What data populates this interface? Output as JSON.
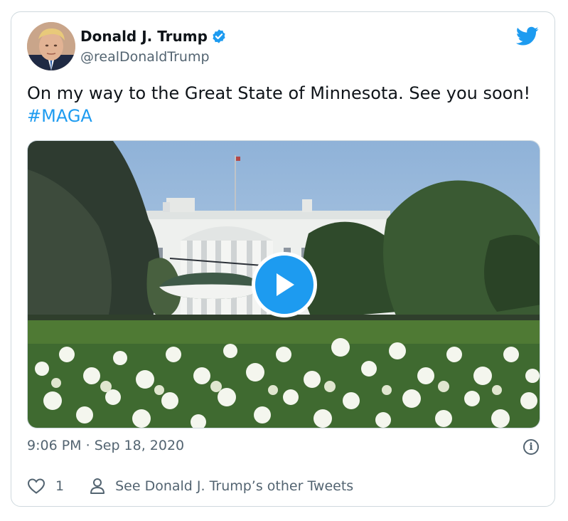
{
  "tweet": {
    "author_name": "Donald J. Trump",
    "author_handle": "@realDonaldTrump",
    "text": "On my way to the Great State of Minnesota. See you soon! ",
    "hashtag": "#MAGA",
    "time": "9:06 PM",
    "separator": " · ",
    "date": "Sep 18, 2020",
    "like_count": "1",
    "other_tweets_label": "See Donald J. Trump’s other Tweets"
  },
  "icons": {
    "brand": "twitter-bird-icon",
    "verified": "verified-badge-icon",
    "play": "play-icon",
    "info": "info-icon",
    "like": "heart-icon",
    "profile": "person-icon"
  },
  "colors": {
    "accent": "#1d9bf0",
    "text": "#0f1419",
    "secondary": "#536471",
    "border": "#cfd9de"
  }
}
